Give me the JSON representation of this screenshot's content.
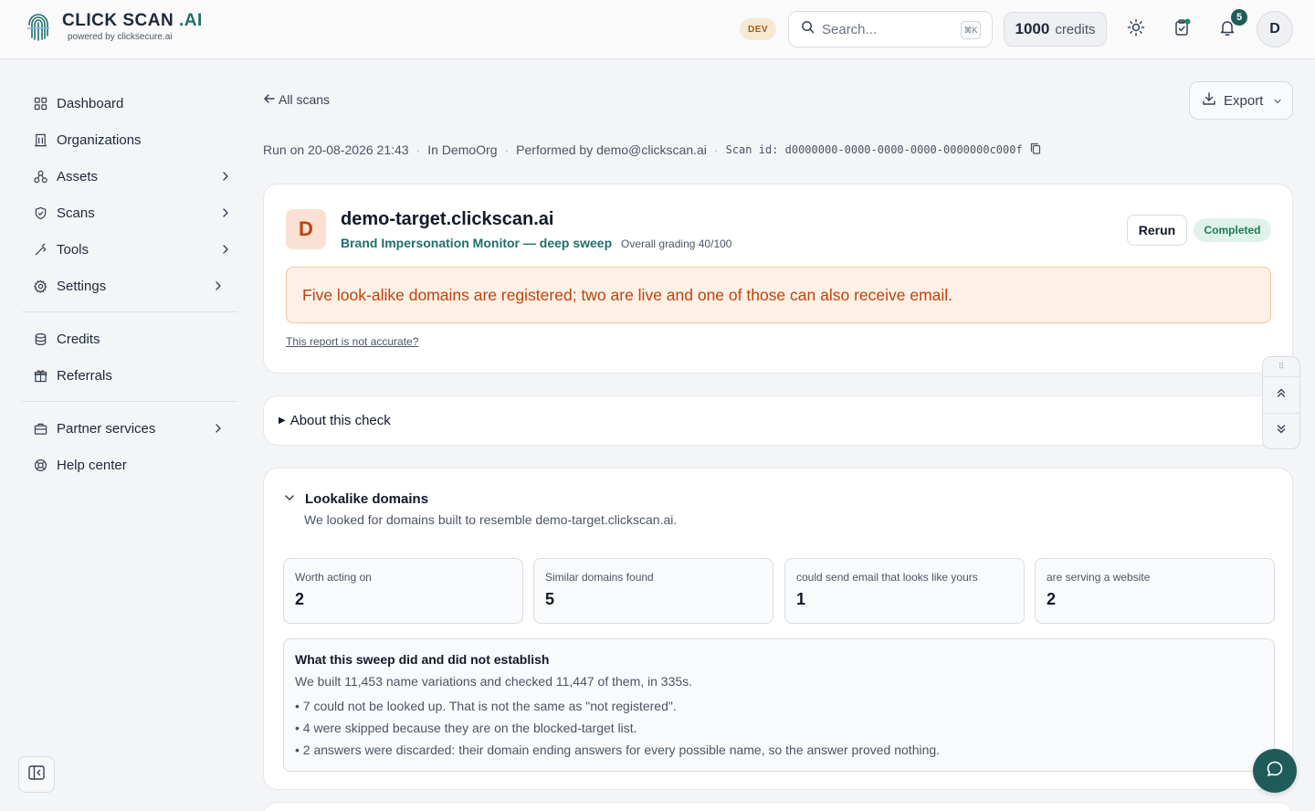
{
  "brand": {
    "name_main": "CLICK SCAN",
    "name_accent": ".AI",
    "tagline": "powered by clicksecure.ai"
  },
  "topbar": {
    "env_badge": "DEV",
    "search_placeholder": "Search...",
    "search_shortcut": "⌘K",
    "credits_value": "1000",
    "credits_label": "credits",
    "notifications_count": "5",
    "avatar_initial": "D"
  },
  "sidebar": {
    "items": [
      {
        "label": "Dashboard",
        "icon": "dashboard-icon",
        "has_chevron": false
      },
      {
        "label": "Organizations",
        "icon": "building-icon",
        "has_chevron": false
      },
      {
        "label": "Assets",
        "icon": "assets-icon",
        "has_chevron": true
      },
      {
        "label": "Scans",
        "icon": "shield-icon",
        "has_chevron": true
      },
      {
        "label": "Tools",
        "icon": "tools-icon",
        "has_chevron": true
      },
      {
        "label": "Settings",
        "icon": "gear-icon",
        "has_chevron": true
      },
      {
        "label": "Credits",
        "icon": "coins-icon",
        "has_chevron": false
      },
      {
        "label": "Referrals",
        "icon": "gift-icon",
        "has_chevron": false
      },
      {
        "label": "Partner services",
        "icon": "briefcase-icon",
        "has_chevron": true
      },
      {
        "label": "Help center",
        "icon": "lifebuoy-icon",
        "has_chevron": false
      }
    ]
  },
  "page": {
    "back_label": "All scans",
    "export_label": "Export",
    "meta": {
      "run_on": "Run on 20-08-2026 21:43",
      "org": "In DemoOrg",
      "performed_by": "Performed by demo@clickscan.ai",
      "scan_id": "Scan id: d0000000-0000-0000-0000-0000000c000f"
    }
  },
  "result": {
    "grade": "D",
    "target": "demo-target.clickscan.ai",
    "check_name": "Brand Impersonation Monitor — deep sweep",
    "grading": "Overall grading 40/100",
    "rerun_label": "Rerun",
    "status": "Completed",
    "summary": "Five look-alike domains are registered; two are live and one of those can also receive email.",
    "accuracy_link": "This report is not accurate?"
  },
  "about": {
    "title": "About this check"
  },
  "lookalike": {
    "title": "Lookalike domains",
    "description": "We looked for domains built to resemble demo-target.clickscan.ai.",
    "stats": [
      {
        "label": "Worth acting on",
        "value": "2"
      },
      {
        "label": "Similar domains found",
        "value": "5"
      },
      {
        "label": "could send email that looks like yours",
        "value": "1"
      },
      {
        "label": "are serving a website",
        "value": "2"
      }
    ],
    "establish": {
      "title": "What this sweep did and did not establish",
      "intro": "We built 11,453 name variations and checked 11,447 of them, in 335s.",
      "bullets": [
        "• 7 could not be looked up. That is not the same as \"not registered\".",
        "• 4 were skipped because they are on the blocked-target list.",
        "• 2 answers were discarded: their domain ending answers for every possible name, so the answer proved nothing."
      ]
    }
  },
  "colors": {
    "accent": "#1f6f6a",
    "grade_bg": "#fbe1d3",
    "grade_fg": "#c2410c",
    "summary_bg": "#fdf1e6",
    "summary_border": "#f0c79a",
    "status_bg": "#dff3ea",
    "status_fg": "#1f7a5a"
  }
}
